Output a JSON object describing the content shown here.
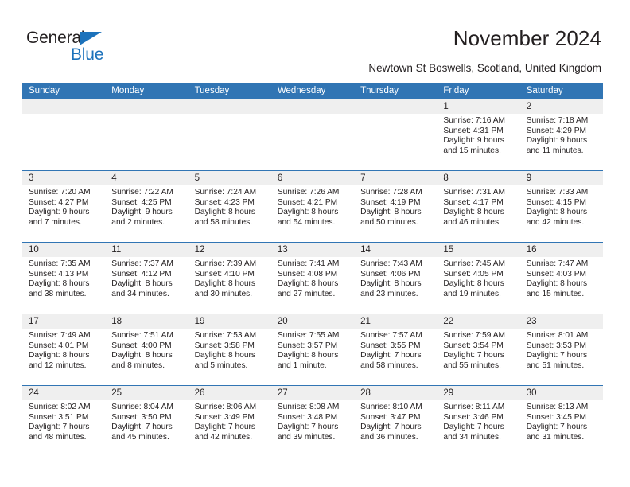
{
  "brand": {
    "name_part1": "General",
    "name_part2": "Blue",
    "logo_icon": "triangle-icon"
  },
  "header": {
    "title": "November 2024",
    "subtitle": "Newtown St Boswells, Scotland, United Kingdom"
  },
  "colors": {
    "header_blue": "#3175b4",
    "brand_blue": "#1c72bb",
    "day_band_gray": "#efefef",
    "text": "#231f20"
  },
  "calendar": {
    "day_names": [
      "Sunday",
      "Monday",
      "Tuesday",
      "Wednesday",
      "Thursday",
      "Friday",
      "Saturday"
    ],
    "weeks": [
      {
        "days": [
          {
            "num": "",
            "lines": []
          },
          {
            "num": "",
            "lines": []
          },
          {
            "num": "",
            "lines": []
          },
          {
            "num": "",
            "lines": []
          },
          {
            "num": "",
            "lines": []
          },
          {
            "num": "1",
            "lines": [
              "Sunrise: 7:16 AM",
              "Sunset: 4:31 PM",
              "Daylight: 9 hours",
              "and 15 minutes."
            ]
          },
          {
            "num": "2",
            "lines": [
              "Sunrise: 7:18 AM",
              "Sunset: 4:29 PM",
              "Daylight: 9 hours",
              "and 11 minutes."
            ]
          }
        ]
      },
      {
        "days": [
          {
            "num": "3",
            "lines": [
              "Sunrise: 7:20 AM",
              "Sunset: 4:27 PM",
              "Daylight: 9 hours",
              "and 7 minutes."
            ]
          },
          {
            "num": "4",
            "lines": [
              "Sunrise: 7:22 AM",
              "Sunset: 4:25 PM",
              "Daylight: 9 hours",
              "and 2 minutes."
            ]
          },
          {
            "num": "5",
            "lines": [
              "Sunrise: 7:24 AM",
              "Sunset: 4:23 PM",
              "Daylight: 8 hours",
              "and 58 minutes."
            ]
          },
          {
            "num": "6",
            "lines": [
              "Sunrise: 7:26 AM",
              "Sunset: 4:21 PM",
              "Daylight: 8 hours",
              "and 54 minutes."
            ]
          },
          {
            "num": "7",
            "lines": [
              "Sunrise: 7:28 AM",
              "Sunset: 4:19 PM",
              "Daylight: 8 hours",
              "and 50 minutes."
            ]
          },
          {
            "num": "8",
            "lines": [
              "Sunrise: 7:31 AM",
              "Sunset: 4:17 PM",
              "Daylight: 8 hours",
              "and 46 minutes."
            ]
          },
          {
            "num": "9",
            "lines": [
              "Sunrise: 7:33 AM",
              "Sunset: 4:15 PM",
              "Daylight: 8 hours",
              "and 42 minutes."
            ]
          }
        ]
      },
      {
        "days": [
          {
            "num": "10",
            "lines": [
              "Sunrise: 7:35 AM",
              "Sunset: 4:13 PM",
              "Daylight: 8 hours",
              "and 38 minutes."
            ]
          },
          {
            "num": "11",
            "lines": [
              "Sunrise: 7:37 AM",
              "Sunset: 4:12 PM",
              "Daylight: 8 hours",
              "and 34 minutes."
            ]
          },
          {
            "num": "12",
            "lines": [
              "Sunrise: 7:39 AM",
              "Sunset: 4:10 PM",
              "Daylight: 8 hours",
              "and 30 minutes."
            ]
          },
          {
            "num": "13",
            "lines": [
              "Sunrise: 7:41 AM",
              "Sunset: 4:08 PM",
              "Daylight: 8 hours",
              "and 27 minutes."
            ]
          },
          {
            "num": "14",
            "lines": [
              "Sunrise: 7:43 AM",
              "Sunset: 4:06 PM",
              "Daylight: 8 hours",
              "and 23 minutes."
            ]
          },
          {
            "num": "15",
            "lines": [
              "Sunrise: 7:45 AM",
              "Sunset: 4:05 PM",
              "Daylight: 8 hours",
              "and 19 minutes."
            ]
          },
          {
            "num": "16",
            "lines": [
              "Sunrise: 7:47 AM",
              "Sunset: 4:03 PM",
              "Daylight: 8 hours",
              "and 15 minutes."
            ]
          }
        ]
      },
      {
        "days": [
          {
            "num": "17",
            "lines": [
              "Sunrise: 7:49 AM",
              "Sunset: 4:01 PM",
              "Daylight: 8 hours",
              "and 12 minutes."
            ]
          },
          {
            "num": "18",
            "lines": [
              "Sunrise: 7:51 AM",
              "Sunset: 4:00 PM",
              "Daylight: 8 hours",
              "and 8 minutes."
            ]
          },
          {
            "num": "19",
            "lines": [
              "Sunrise: 7:53 AM",
              "Sunset: 3:58 PM",
              "Daylight: 8 hours",
              "and 5 minutes."
            ]
          },
          {
            "num": "20",
            "lines": [
              "Sunrise: 7:55 AM",
              "Sunset: 3:57 PM",
              "Daylight: 8 hours",
              "and 1 minute."
            ]
          },
          {
            "num": "21",
            "lines": [
              "Sunrise: 7:57 AM",
              "Sunset: 3:55 PM",
              "Daylight: 7 hours",
              "and 58 minutes."
            ]
          },
          {
            "num": "22",
            "lines": [
              "Sunrise: 7:59 AM",
              "Sunset: 3:54 PM",
              "Daylight: 7 hours",
              "and 55 minutes."
            ]
          },
          {
            "num": "23",
            "lines": [
              "Sunrise: 8:01 AM",
              "Sunset: 3:53 PM",
              "Daylight: 7 hours",
              "and 51 minutes."
            ]
          }
        ]
      },
      {
        "days": [
          {
            "num": "24",
            "lines": [
              "Sunrise: 8:02 AM",
              "Sunset: 3:51 PM",
              "Daylight: 7 hours",
              "and 48 minutes."
            ]
          },
          {
            "num": "25",
            "lines": [
              "Sunrise: 8:04 AM",
              "Sunset: 3:50 PM",
              "Daylight: 7 hours",
              "and 45 minutes."
            ]
          },
          {
            "num": "26",
            "lines": [
              "Sunrise: 8:06 AM",
              "Sunset: 3:49 PM",
              "Daylight: 7 hours",
              "and 42 minutes."
            ]
          },
          {
            "num": "27",
            "lines": [
              "Sunrise: 8:08 AM",
              "Sunset: 3:48 PM",
              "Daylight: 7 hours",
              "and 39 minutes."
            ]
          },
          {
            "num": "28",
            "lines": [
              "Sunrise: 8:10 AM",
              "Sunset: 3:47 PM",
              "Daylight: 7 hours",
              "and 36 minutes."
            ]
          },
          {
            "num": "29",
            "lines": [
              "Sunrise: 8:11 AM",
              "Sunset: 3:46 PM",
              "Daylight: 7 hours",
              "and 34 minutes."
            ]
          },
          {
            "num": "30",
            "lines": [
              "Sunrise: 8:13 AM",
              "Sunset: 3:45 PM",
              "Daylight: 7 hours",
              "and 31 minutes."
            ]
          }
        ]
      }
    ]
  }
}
